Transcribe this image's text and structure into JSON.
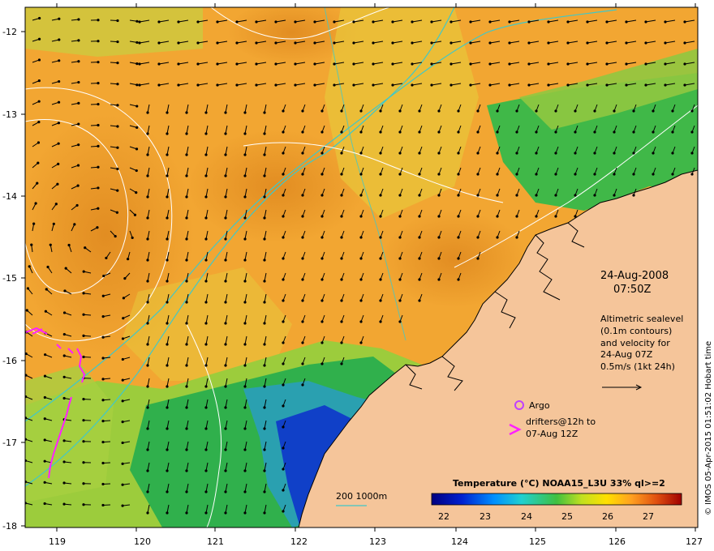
{
  "map": {
    "lon_range": [
      118.6,
      127
    ],
    "lat_range": [
      -18,
      -11.8
    ],
    "lon_ticks": [
      "119",
      "120",
      "121",
      "122",
      "123",
      "124",
      "125",
      "126",
      "127"
    ],
    "lat_ticks": [
      "-12",
      "-13",
      "-14",
      "-15",
      "-16",
      "-17",
      "-18"
    ]
  },
  "annotations": {
    "date": "24-Aug-2008",
    "time": "07:50Z",
    "description": [
      "Altimetric sealevel",
      "(0.1m contours)",
      "and velocity for",
      "24-Aug 07Z",
      "0.5m/s (1kt 24h)"
    ],
    "argo_label": "Argo",
    "drifters_label": [
      "drifters@12h to",
      "07-Aug 12Z"
    ],
    "depth_label": "200  1000m",
    "credit": "© IMOS 05-Apr-2015 01:51:02 Hobart time"
  },
  "colorbar": {
    "title": "Temperature (°C) NOAA15_L3U 33% ql>=2",
    "ticks": [
      "22",
      "23",
      "24",
      "25",
      "26",
      "27"
    ],
    "range": [
      21.8,
      27.9
    ]
  },
  "colors": {
    "land": "#f5c59a",
    "warm_sst": "#f0a030",
    "cool_sst": "#22b04a",
    "cold_sst": "#1030c0",
    "isobath": "#40c8c8",
    "contour": "#ffffff",
    "drifter": "#ff20ff",
    "argo": "#c040ff"
  }
}
